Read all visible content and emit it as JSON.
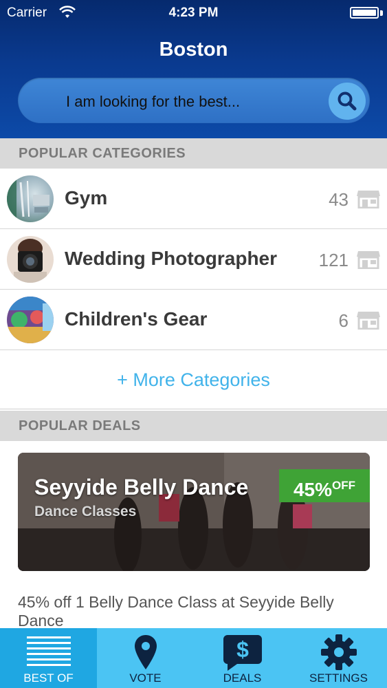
{
  "status_bar": {
    "carrier": "Carrier",
    "time": "4:23 PM"
  },
  "header": {
    "city": "Boston"
  },
  "search": {
    "placeholder": "I am looking for the best..."
  },
  "popular_categories": {
    "heading": "POPULAR CATEGORIES",
    "items": [
      {
        "name": "Gym",
        "count": "43",
        "thumb_icon": "gym-photo"
      },
      {
        "name": "Wedding Photographer",
        "count": "121",
        "thumb_icon": "photographer-photo"
      },
      {
        "name": "Children's Gear",
        "count": "6",
        "thumb_icon": "toys-photo"
      }
    ],
    "more_label": "+ More Categories"
  },
  "popular_deals": {
    "heading": "POPULAR DEALS",
    "deal": {
      "title": "Seyyide Belly Dance",
      "subtitle": "Dance Classes",
      "discount": "45%",
      "discount_suffix": "OFF",
      "description": "45% off 1 Belly Dance Class at Seyyide Belly Dance"
    }
  },
  "tabbar": {
    "tabs": [
      {
        "label": "BEST OF",
        "icon": "list-icon",
        "active": true
      },
      {
        "label": "VOTE",
        "icon": "pin-icon",
        "active": false
      },
      {
        "label": "DEALS",
        "icon": "dollar-bubble-icon",
        "active": false
      },
      {
        "label": "SETTINGS",
        "icon": "gear-icon",
        "active": false
      }
    ]
  },
  "colors": {
    "header_dark": "#062a6e",
    "header_light": "#0d4aa8",
    "accent_link": "#41b3ea",
    "tabbar": "#4bc4f3",
    "tab_active": "#1fa7e2",
    "deal_badge": "#3fa336"
  }
}
